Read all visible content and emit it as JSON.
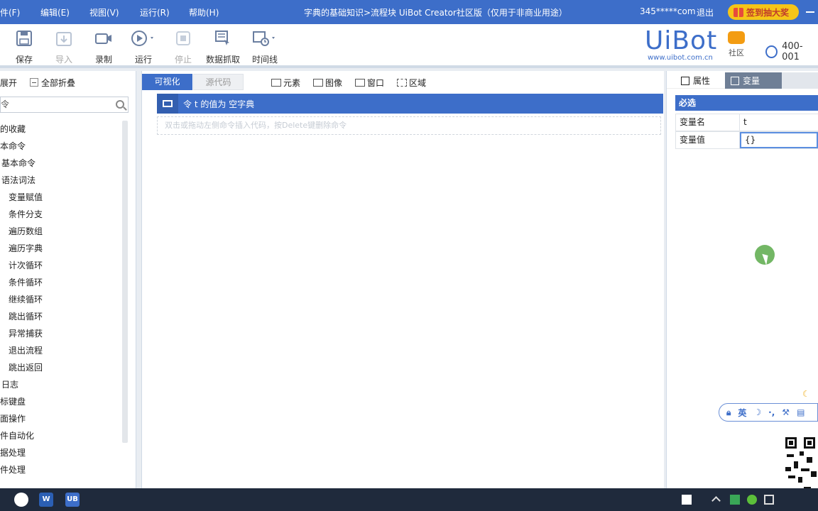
{
  "menubar": {
    "menus": [
      "件(F)",
      "编辑(E)",
      "视图(V)",
      "运行(R)",
      "帮助(H)"
    ],
    "title": "字典的基础知识>流程块 UiBot Creator社区版（仅用于非商业用途）",
    "user": "345*****com",
    "logout": "退出",
    "signin": "签到抽大奖"
  },
  "toolbar": {
    "save": "保存",
    "import": "导入",
    "record": "录制",
    "run": "运行",
    "stop": "停止",
    "data_scrape": "数据抓取",
    "timeline": "时间线",
    "logo": "UiBot",
    "logo_url": "www.uibot.com.cn",
    "community": "社区",
    "phone": "400-001"
  },
  "left_panel": {
    "expand": "展开",
    "collapse_all": "全部折叠",
    "search_value": "令",
    "tree": [
      "的收藏",
      "本命令",
      "基本命令",
      "语法词法",
      "变量赋值",
      "条件分支",
      "遍历数组",
      "遍历字典",
      "计次循环",
      "条件循环",
      "继续循环",
      "跳出循环",
      "异常捕获",
      "退出流程",
      "跳出返回",
      "日志",
      "标键盘",
      "面操作",
      "件自动化",
      "据处理",
      "件处理"
    ]
  },
  "center": {
    "tab_visual": "可视化",
    "tab_source": "源代码",
    "picker_element": "元素",
    "picker_image": "图像",
    "picker_window": "窗口",
    "picker_region": "区域",
    "command_text": "令 t 的值为 空字典",
    "drop_hint": "双击或拖动左侧命令插入代码，按Delete键删除命令"
  },
  "right_panel": {
    "tab_properties": "属性",
    "tab_variables": "变量",
    "section_required": "必选",
    "prop_name_key": "变量名",
    "prop_name_value": "t",
    "prop_value_key": "变量值",
    "prop_value_value": "{}"
  },
  "ime": {
    "lang": "英"
  },
  "taskbar": {
    "app_label": "UB"
  },
  "colors": {
    "accent": "#3d6ec9",
    "signin_bg": "#f5c518",
    "taskbar": "#1f2a3c"
  }
}
